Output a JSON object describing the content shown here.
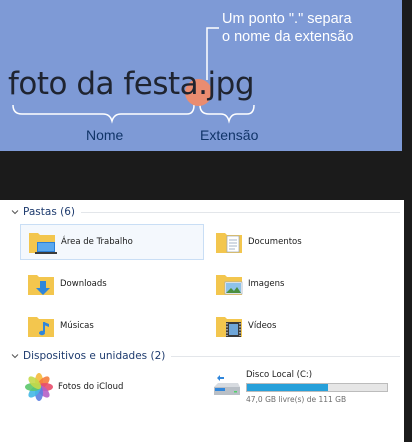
{
  "illustration": {
    "filename": "foto da festa.jpg",
    "note_line1": "Um ponto \".\" separa",
    "note_line2": "o nome da extensão",
    "label_name": "Nome",
    "label_extension": "Extensão",
    "colors": {
      "background": "#7e9ad6",
      "highlight": "#f08b6a",
      "label": "#103468"
    }
  },
  "explorer": {
    "folders_header": "Pastas (6)",
    "folders": [
      {
        "label": "Área de Trabalho",
        "icon": "desktop-folder-icon"
      },
      {
        "label": "Documentos",
        "icon": "documents-folder-icon"
      },
      {
        "label": "Downloads",
        "icon": "downloads-folder-icon"
      },
      {
        "label": "Imagens",
        "icon": "pictures-folder-icon"
      },
      {
        "label": "Músicas",
        "icon": "music-folder-icon"
      },
      {
        "label": "Vídeos",
        "icon": "videos-folder-icon"
      }
    ],
    "devices_header": "Dispositivos e unidades (2)",
    "icloud": {
      "label": "Fotos do iCloud",
      "icon": "icloud-photos-icon"
    },
    "drive": {
      "label": "Disco Local (C:)",
      "free_text": "47,0 GB livre(s) de 111 GB",
      "used_fraction": 0.58,
      "icon": "hard-drive-icon"
    }
  }
}
